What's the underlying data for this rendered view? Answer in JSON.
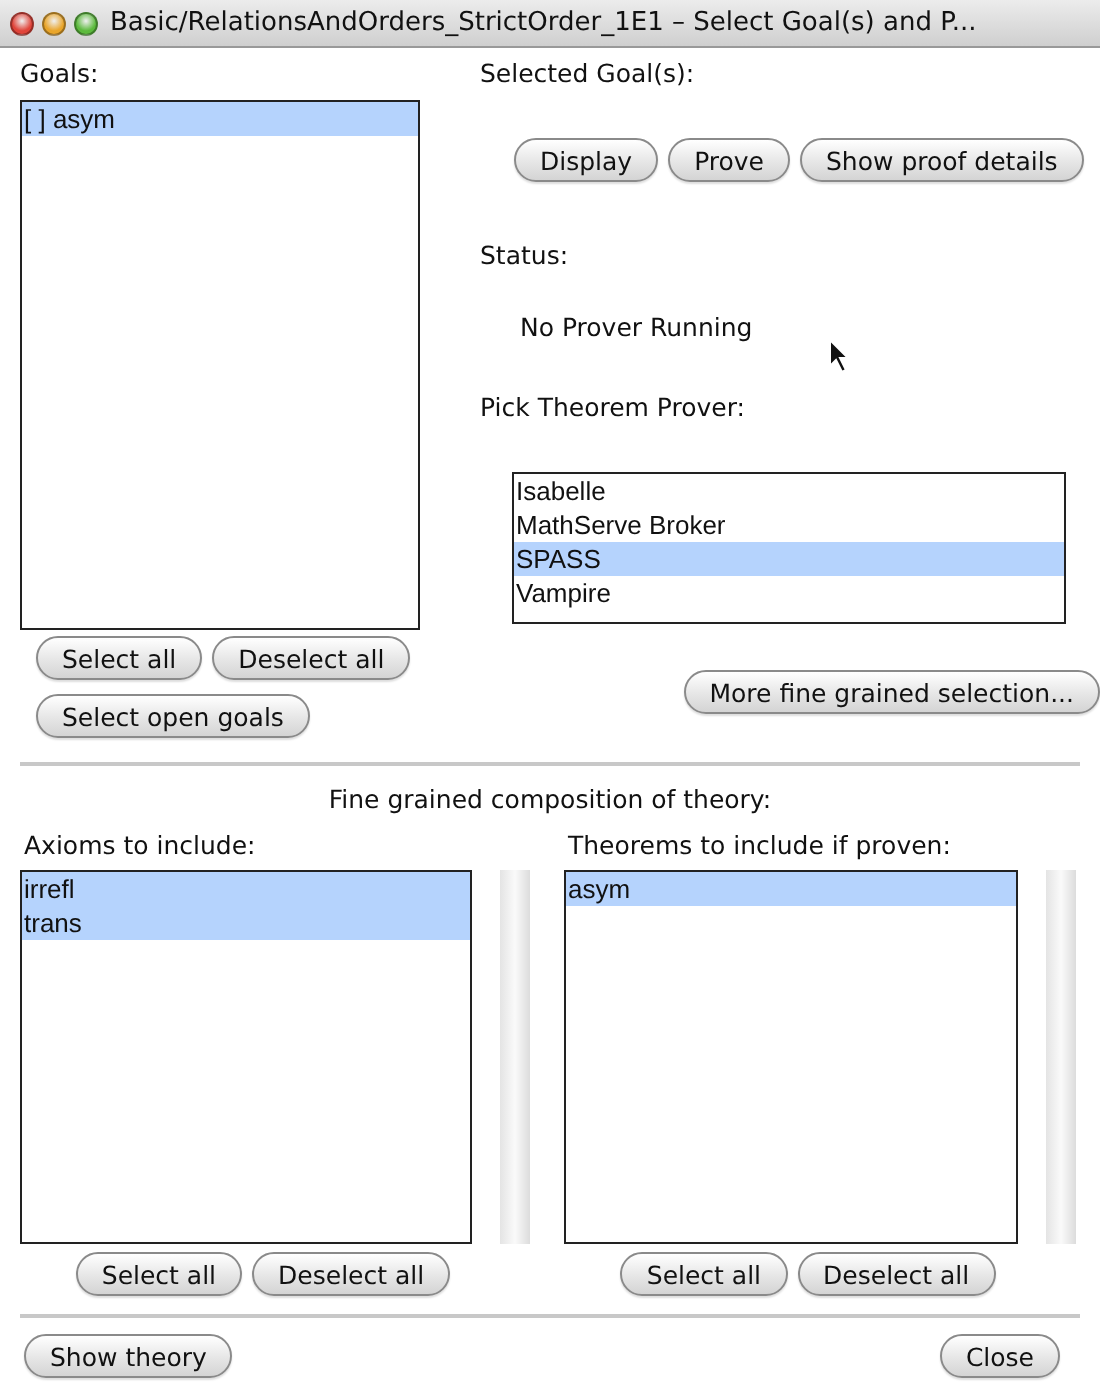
{
  "window": {
    "title": "Basic/RelationsAndOrders_StrictOrder_1E1 – Select Goal(s) and P..."
  },
  "goals": {
    "label": "Goals:",
    "items": [
      {
        "text": "[ ] asym",
        "selected": true
      }
    ],
    "buttons": [
      "Select all",
      "Deselect all"
    ],
    "extra_button": "Select open goals"
  },
  "selected_goals": {
    "label": "Selected Goal(s):",
    "buttons": [
      "Display",
      "Prove",
      "Show proof details"
    ]
  },
  "status": {
    "label": "Status:",
    "text": "No Prover Running"
  },
  "prover": {
    "label": "Pick Theorem Prover:",
    "items": [
      {
        "text": "Isabelle",
        "selected": false
      },
      {
        "text": "MathServe Broker",
        "selected": false
      },
      {
        "text": "SPASS",
        "selected": true
      },
      {
        "text": "Vampire",
        "selected": false
      }
    ],
    "button": "More fine grained selection..."
  },
  "composition": {
    "heading": "Fine grained composition of theory:",
    "axioms": {
      "label": "Axioms to include:",
      "items": [
        {
          "text": "irrefl",
          "selected": true
        },
        {
          "text": "trans",
          "selected": true
        }
      ],
      "buttons": [
        "Select all",
        "Deselect all"
      ]
    },
    "theorems": {
      "label": "Theorems to include if proven:",
      "items": [
        {
          "text": "asym",
          "selected": true
        }
      ],
      "buttons": [
        "Select all",
        "Deselect all"
      ]
    }
  },
  "footer": {
    "left_button": "Show theory",
    "right_button": "Close"
  }
}
